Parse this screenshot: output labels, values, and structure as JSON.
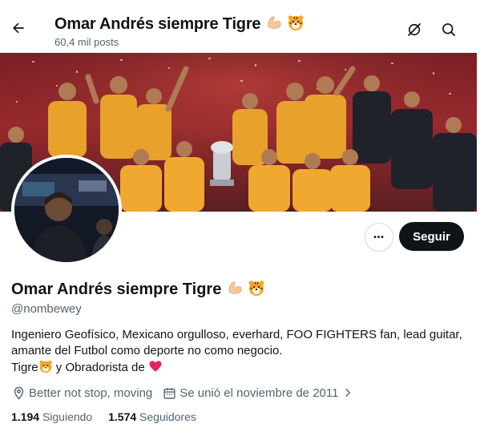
{
  "header": {
    "title": "Omar Andrés siempre Tigre",
    "posts_count": "60,4 mil posts",
    "back_icon": "arrow-left-icon",
    "grok_icon": "grok-icon",
    "search_icon": "search-icon"
  },
  "profile": {
    "display_name": "Omar Andrés siempre Tigre",
    "name_emojis": [
      "flexed-biceps-emoji",
      "tiger-face-emoji"
    ],
    "handle": "@nombewey",
    "bio_lines": [
      "Ingeniero Geofísico, Mexicano orgulloso, everhard, FOO FIGHTERS fan, lead guitar,",
      "amante del Futbol como deporte no como negocio."
    ],
    "bio_line3_a": "Tigre",
    "bio_line3_b": " y Obradorista de ",
    "location": "Better not stop, moving",
    "joined": "Se unió el noviembre de 2011",
    "following_count": "1.194",
    "following_label": "Siguiendo",
    "followers_count": "1.574",
    "followers_label": "Seguidores"
  },
  "actions": {
    "more_label": "•••",
    "follow_label": "Seguir"
  },
  "colors": {
    "text_primary": "#0f1419",
    "text_secondary": "#536471",
    "follow_bg": "#0f1419",
    "heart": "#e0245e",
    "team_gold": "#f5a623"
  }
}
